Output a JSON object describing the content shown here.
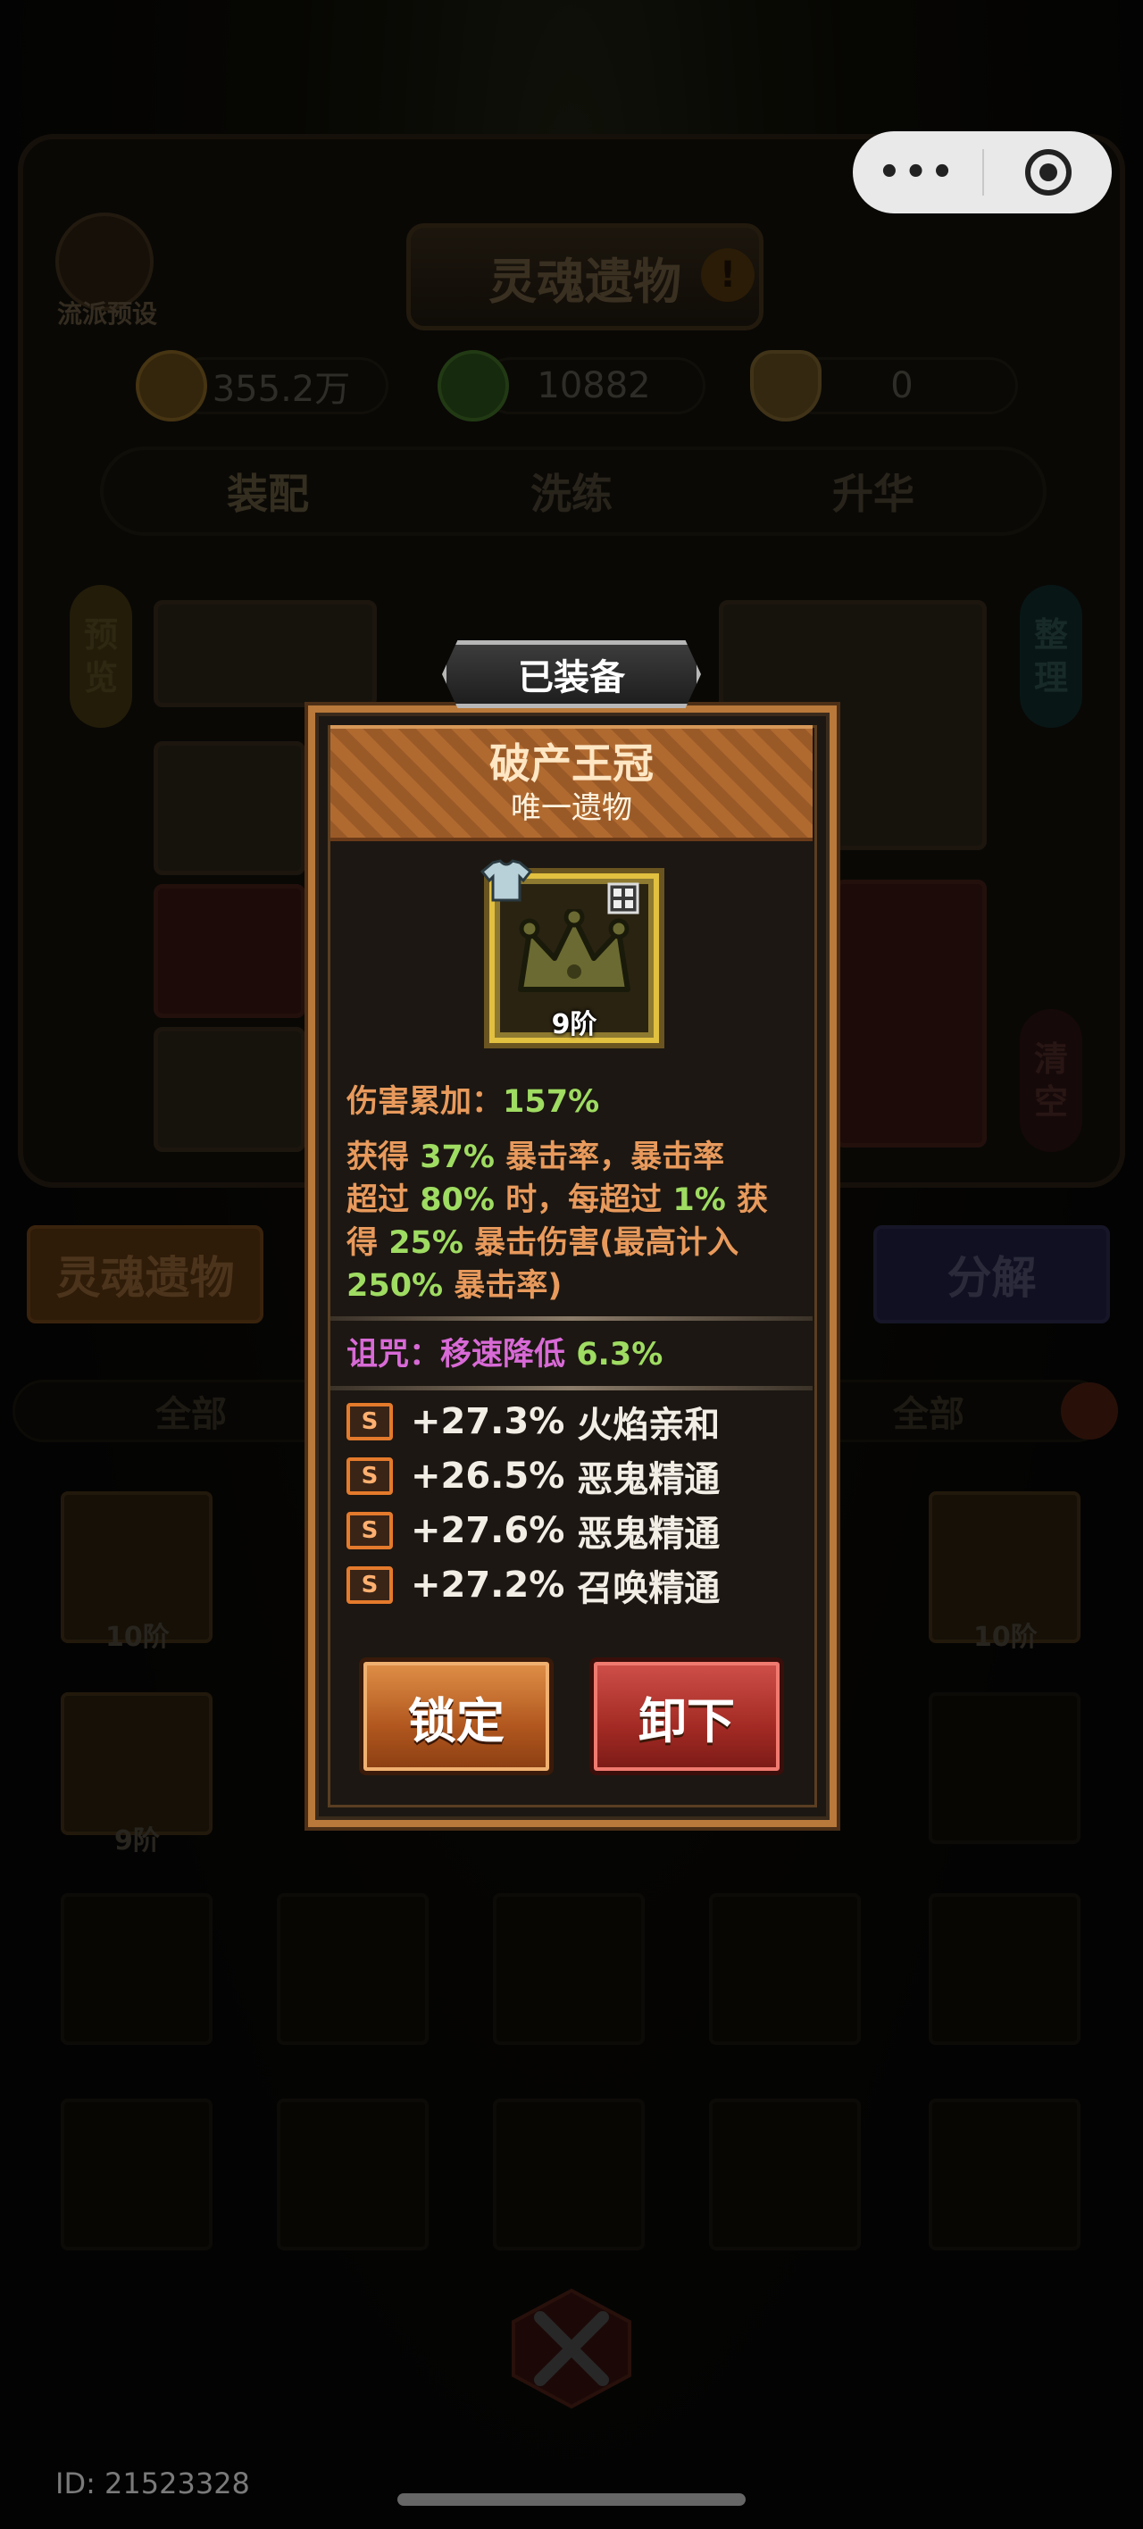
{
  "header": {
    "preset_label": "流派预设",
    "title": "灵魂遗物",
    "info_icon": "!"
  },
  "resources": [
    {
      "icon": "coin-icon",
      "value": "355.2万"
    },
    {
      "icon": "soul-icon",
      "value": "10882"
    },
    {
      "icon": "tooth-icon",
      "value": "0"
    }
  ],
  "tabs": [
    "装配",
    "洗练",
    "升华"
  ],
  "side_buttons": {
    "preview": "预览",
    "arrange": "整理",
    "clear": "清空"
  },
  "actions": {
    "soul_relic": "灵魂遗物",
    "decompose": "分解"
  },
  "filters": {
    "left": "全部",
    "right": "全部"
  },
  "inventory": {
    "tier_10": "10阶",
    "tier_9": "9阶"
  },
  "popup": {
    "status_tag": "已装备",
    "item_name": "破产王冠",
    "item_rarity": "唯一遗物",
    "item_tier": "9阶",
    "damage_label": "伤害累加：",
    "damage_value": "157%",
    "desc": {
      "p1": "获得",
      "v1": "37%",
      "p2": "暴击率，暴击率",
      "p3": "超过",
      "v2": "80%",
      "p4": "时，每超过",
      "v3": "1%",
      "p5": "获",
      "p6": "得",
      "v4": "25%",
      "p7": "暴击伤害(最高计入",
      "v5": "250%",
      "p8": "暴击率)"
    },
    "curse_label": "诅咒：移速降低",
    "curse_value": "6.3%",
    "affixes": [
      {
        "badge": "S",
        "value": "+27.3%",
        "name": "火焰亲和"
      },
      {
        "badge": "S",
        "value": "+26.5%",
        "name": "恶鬼精通"
      },
      {
        "badge": "S",
        "value": "+27.6%",
        "name": "恶鬼精通"
      },
      {
        "badge": "S",
        "value": "+27.2%",
        "name": "召唤精通"
      }
    ],
    "lock_button": "锁定",
    "unequip_button": "卸下"
  },
  "footer": {
    "user_id": "ID: 21523328"
  },
  "colors": {
    "accent_orange": "#e89a5c",
    "value_green": "#9fdc62",
    "curse_purple": "#d86ad6",
    "frame_gold": "#b8793a"
  }
}
